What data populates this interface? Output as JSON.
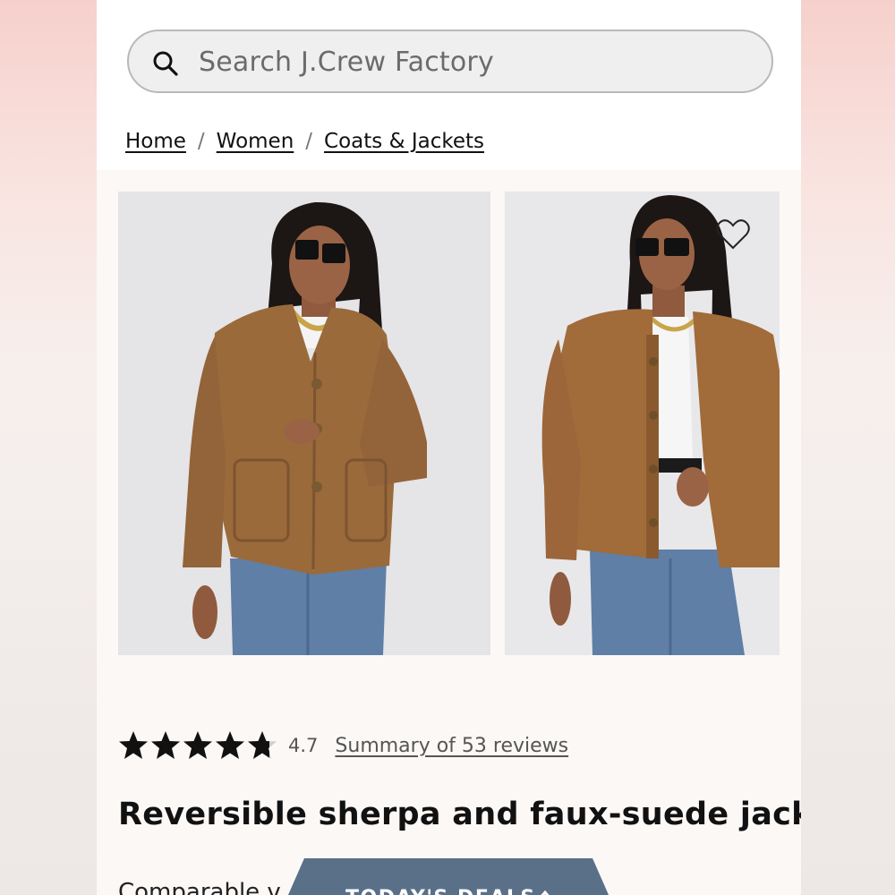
{
  "search": {
    "placeholder": "Search J.Crew Factory",
    "icon": "search-icon"
  },
  "breadcrumb": {
    "items": [
      {
        "label": "Home"
      },
      {
        "label": "Women"
      },
      {
        "label": "Coats & Jackets"
      }
    ],
    "separator": "/"
  },
  "product": {
    "images": [
      {
        "icon": "jacket-photo-suede-side"
      },
      {
        "icon": "jacket-photo-sherpa-side"
      }
    ],
    "wishlist_icon": "heart-icon",
    "rating": {
      "value": "4.7",
      "stars": 4.7,
      "max_stars": 5,
      "reviews_link": "Summary of 53 reviews"
    },
    "title": "Reversible sherpa and faux-suede jacket",
    "partial_line": "Comparable v"
  },
  "deals_tab": {
    "label": "TODAY'S DEALS",
    "icon": "chevron-up-icon",
    "color": "#5a7089"
  },
  "colors": {
    "jacket": "#9a6a3a",
    "denim": "#5f7fa6",
    "page_bg": "#fbf8f6",
    "search_bg": "#efefef"
  }
}
